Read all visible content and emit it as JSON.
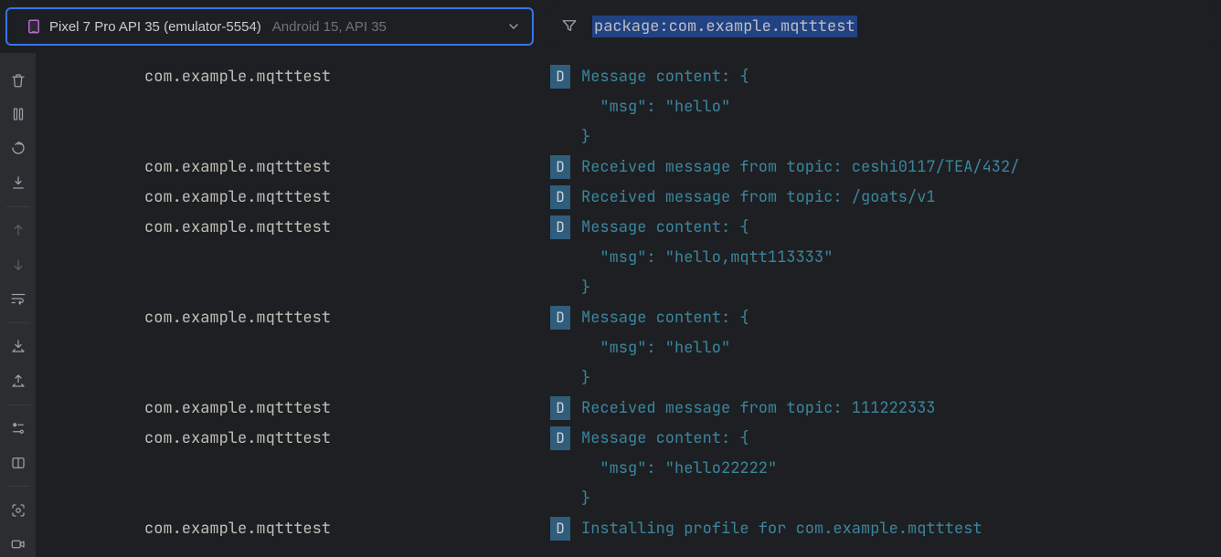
{
  "device": {
    "name": "Pixel 7 Pro API 35 (emulator-5554)",
    "subtitle": "Android 15, API 35"
  },
  "filter": {
    "value": "package:com.example.mqtttest"
  },
  "sidebar": [
    {
      "id": "trash",
      "title": "Clear"
    },
    {
      "id": "pause",
      "title": "Pause"
    },
    {
      "id": "restart",
      "title": "Restart"
    },
    {
      "id": "scroll-end",
      "title": "Scroll to End"
    },
    {
      "id": "divider"
    },
    {
      "id": "up",
      "title": "Previous",
      "disabled": true
    },
    {
      "id": "down",
      "title": "Next",
      "disabled": true
    },
    {
      "id": "wrap",
      "title": "Soft-Wrap"
    },
    {
      "id": "divider"
    },
    {
      "id": "import",
      "title": "Import"
    },
    {
      "id": "export",
      "title": "Export"
    },
    {
      "id": "divider"
    },
    {
      "id": "settings",
      "title": "Settings"
    },
    {
      "id": "split",
      "title": "Split"
    },
    {
      "id": "divider"
    },
    {
      "id": "screenshot",
      "title": "Screenshot"
    },
    {
      "id": "record",
      "title": "Record"
    }
  ],
  "logs": [
    {
      "tag": "com.example.mqtttest",
      "level": "D",
      "lines": [
        "Message content: {",
        "  \"msg\": \"hello\"",
        "}"
      ]
    },
    {
      "tag": "com.example.mqtttest",
      "level": "D",
      "lines": [
        "Received message from topic: ceshi0117/TEA/432/"
      ]
    },
    {
      "tag": "com.example.mqtttest",
      "level": "D",
      "lines": [
        "Received message from topic: /goats/v1"
      ]
    },
    {
      "tag": "com.example.mqtttest",
      "level": "D",
      "lines": [
        "Message content: {",
        "  \"msg\": \"hello,mqtt113333\"",
        "}"
      ]
    },
    {
      "tag": "com.example.mqtttest",
      "level": "D",
      "lines": [
        "Message content: {",
        "  \"msg\": \"hello\"",
        "}"
      ]
    },
    {
      "tag": "com.example.mqtttest",
      "level": "D",
      "lines": [
        "Received message from topic: 111222333"
      ]
    },
    {
      "tag": "com.example.mqtttest",
      "level": "D",
      "lines": [
        "Message content: {",
        "  \"msg\": \"hello22222\"",
        "}"
      ]
    },
    {
      "tag": "com.example.mqtttest",
      "level": "D",
      "lines": [
        "Installing profile for com.example.mqtttest"
      ]
    }
  ]
}
